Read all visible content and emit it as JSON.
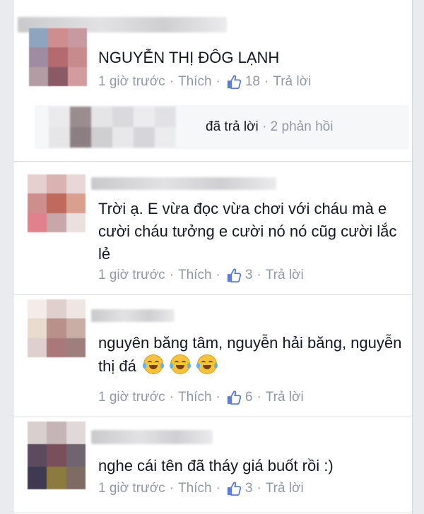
{
  "comments": [
    {
      "text": "NGUYỄN THỊ ĐÔG LẠNH",
      "time": "1 giờ trước",
      "like_action": "Thích",
      "like_count": "18",
      "reply_action": "Trả lời",
      "replies_summary": {
        "replied_label": "đã trả lời",
        "count_label": "2 phản hồi"
      }
    },
    {
      "text": "Trời ạ. E vừa đọc vừa chơi với cháu mà e cười cháu tưởng e cười nó nó cũg cười lắc lẻ",
      "time": "1 giờ trước",
      "like_action": "Thích",
      "like_count": "3",
      "reply_action": "Trả lời"
    },
    {
      "text": "nguyên băng tâm, nguyễn hải băng, nguyễn thị đá",
      "emoji": [
        "face-with-tears-of-joy-icon",
        "face-with-tears-of-joy-icon",
        "face-with-tears-of-joy-icon"
      ],
      "time": "1 giờ trước",
      "like_action": "Thích",
      "like_count": "6",
      "reply_action": "Trả lời"
    },
    {
      "text": "nghe cái tên đã tháy giá buốt rồi :)",
      "time": "1 giờ trước",
      "like_action": "Thích",
      "like_count": "3",
      "reply_action": "Trả lời"
    }
  ],
  "colors": {
    "text": "#141823",
    "meta": "#9197a3",
    "like_icon": "#5b7bd5",
    "reply_box_bg": "#f6f7f9"
  }
}
